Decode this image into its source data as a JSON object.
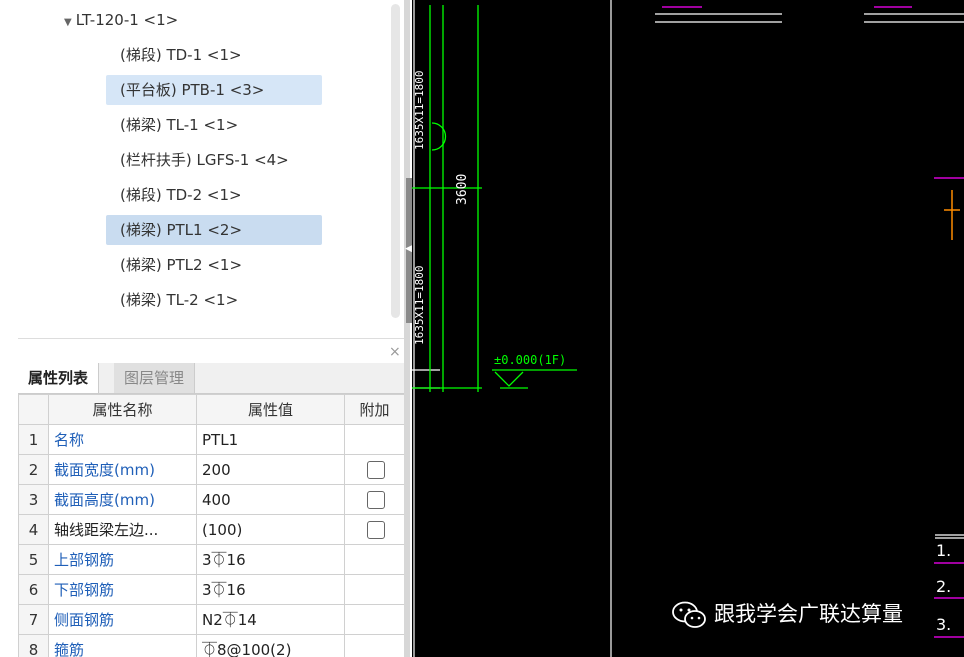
{
  "tree": {
    "root_label": "LT-120-1 <1>",
    "items": [
      {
        "label": "(梯段) TD-1 <1>",
        "selected": false
      },
      {
        "label": "(平台板) PTB-1 <3>",
        "selected": true
      },
      {
        "label": "(梯梁) TL-1 <1>",
        "selected": false
      },
      {
        "label": "(栏杆扶手) LGFS-1 <4>",
        "selected": false
      },
      {
        "label": "(梯段) TD-2 <1>",
        "selected": false
      },
      {
        "label": "(梯梁) PTL1 <2>",
        "selected": true
      },
      {
        "label": "(梯梁) PTL2 <1>",
        "selected": false
      },
      {
        "label": "(梯梁) TL-2 <1>",
        "selected": false
      }
    ]
  },
  "panel": {
    "close_icon": "×",
    "tabs": [
      "属性列表",
      "图层管理"
    ],
    "columns": [
      "属性名称",
      "属性值",
      "附加"
    ],
    "rows": [
      {
        "idx": "1",
        "name": "名称",
        "value": "PTL1",
        "checkbox": false,
        "color": "blue"
      },
      {
        "idx": "2",
        "name": "截面宽度(mm)",
        "value": "200",
        "checkbox": true,
        "color": "blue"
      },
      {
        "idx": "3",
        "name": "截面高度(mm)",
        "value": "400",
        "checkbox": true,
        "color": "blue"
      },
      {
        "idx": "4",
        "name": "轴线距梁左边...",
        "value": "(100)",
        "checkbox": true,
        "color": "black"
      },
      {
        "idx": "5",
        "name": "上部钢筋",
        "value": "3⏁16",
        "checkbox": false,
        "color": "blue"
      },
      {
        "idx": "6",
        "name": "下部钢筋",
        "value": "3⏁16",
        "checkbox": false,
        "color": "blue"
      },
      {
        "idx": "7",
        "name": "侧面钢筋",
        "value": "N2⏁14",
        "checkbox": false,
        "color": "blue"
      },
      {
        "idx": "8",
        "name": "箍筋",
        "value": "⏁8@100(2)",
        "checkbox": false,
        "color": "blue"
      }
    ]
  },
  "cad": {
    "dim_left_top": "1635X11=1800",
    "dim_left_bottom": "1635X11=1800",
    "dim_height": "3600",
    "elevation": "±0.000(1F)",
    "right_labels": [
      "1.",
      "2.",
      "3."
    ],
    "line_color": "#00ff00",
    "accent_magenta": "#ff00ff"
  },
  "watermark": {
    "text": "跟我学会广联达算量",
    "icon": "wechat-icon"
  }
}
